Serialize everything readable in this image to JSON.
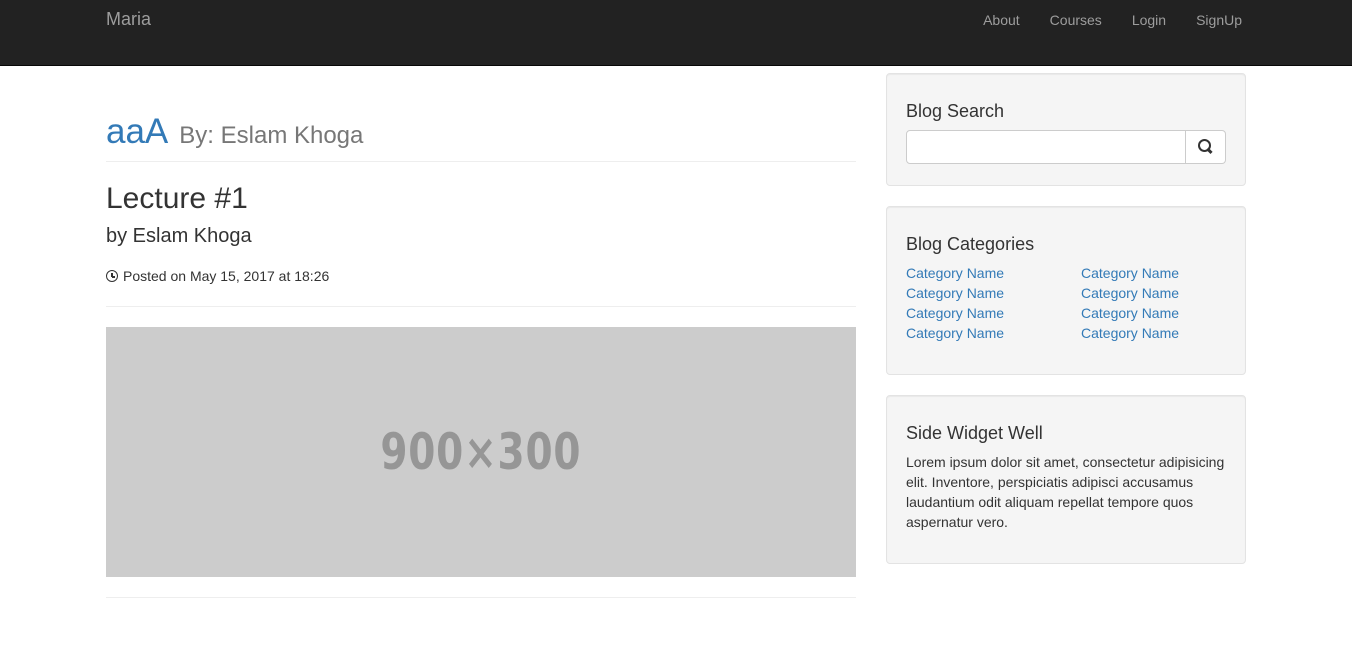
{
  "navbar": {
    "brand": "Maria",
    "links": [
      "About",
      "Courses",
      "Login",
      "SignUp"
    ]
  },
  "post": {
    "title": "aaA",
    "author": "By: Eslam Khoga",
    "lecture_title": "Lecture #1",
    "lecture_by": "by Eslam Khoga",
    "posted_on": "Posted on May 15, 2017 at 18:26",
    "image_placeholder": "900×300"
  },
  "sidebar": {
    "search": {
      "title": "Blog Search",
      "placeholder": "",
      "icon": "search-icon"
    },
    "categories": {
      "title": "Blog Categories",
      "left": [
        "Category Name",
        "Category Name",
        "Category Name",
        "Category Name"
      ],
      "right": [
        "Category Name",
        "Category Name",
        "Category Name",
        "Category Name"
      ]
    },
    "widget": {
      "title": "Side Widget Well",
      "text": "Lorem ipsum dolor sit amet, consectetur adipisicing elit. Inventore, perspiciatis adipisci accusamus laudantium odit aliquam repellat tempore quos aspernatur vero."
    }
  },
  "colors": {
    "navbar_bg": "#222222",
    "link": "#337ab7",
    "muted": "#777777"
  }
}
